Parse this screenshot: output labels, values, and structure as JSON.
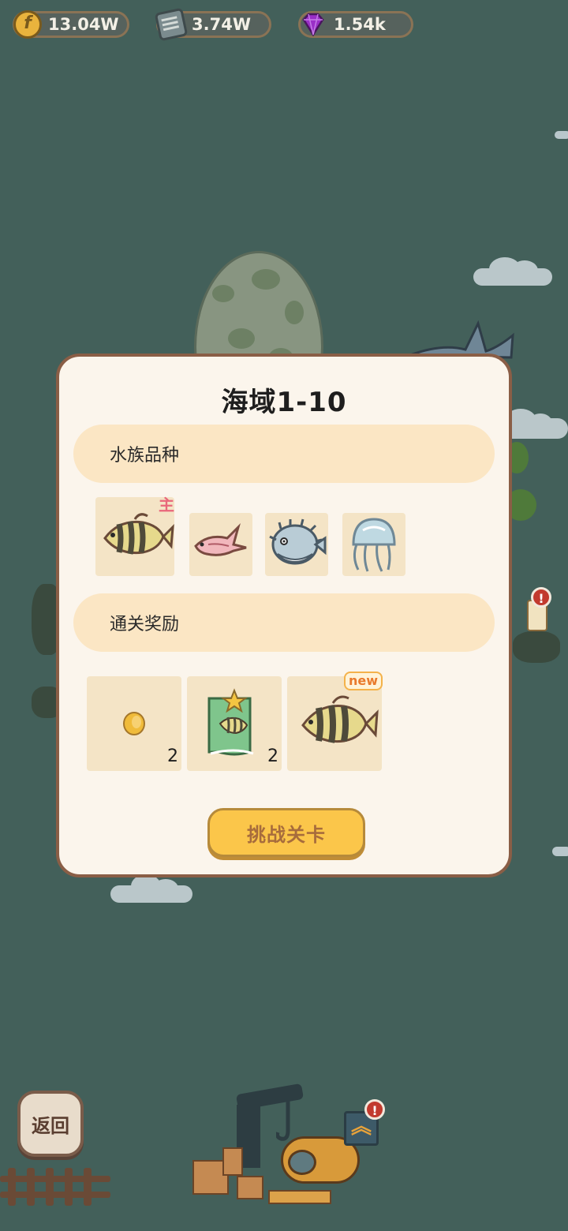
{
  "resources": [
    {
      "icon": "coin-icon",
      "value": "13.04W"
    },
    {
      "icon": "book-stack-icon",
      "value": "3.74W"
    },
    {
      "icon": "purple-gem-icon",
      "value": "1.54k"
    }
  ],
  "dialog": {
    "title": "海域1-10",
    "species_section": {
      "heading": "水族品种",
      "items": [
        {
          "icon": "striped-angelfish-icon",
          "badge": "主"
        },
        {
          "icon": "pink-fish-icon"
        },
        {
          "icon": "pufferfish-icon"
        },
        {
          "icon": "jellyfish-icon"
        }
      ]
    },
    "reward_section": {
      "heading": "通关奖励",
      "items": [
        {
          "icon": "coin-reward-icon",
          "count": "2"
        },
        {
          "icon": "fish-card-icon",
          "count": "2"
        },
        {
          "icon": "striped-angelfish-icon",
          "badge": "new"
        }
      ]
    },
    "challenge_button": "挑战关卡"
  },
  "back_button": "返回",
  "alerts": [
    "!",
    "!"
  ],
  "colors": {
    "background": "#43605a",
    "dialog_bg": "#fbf5ec",
    "section_bg": "#fbe6c4",
    "button": "#fbc64a",
    "new_badge": "#e97a2c",
    "main_badge": "#e9677b"
  }
}
